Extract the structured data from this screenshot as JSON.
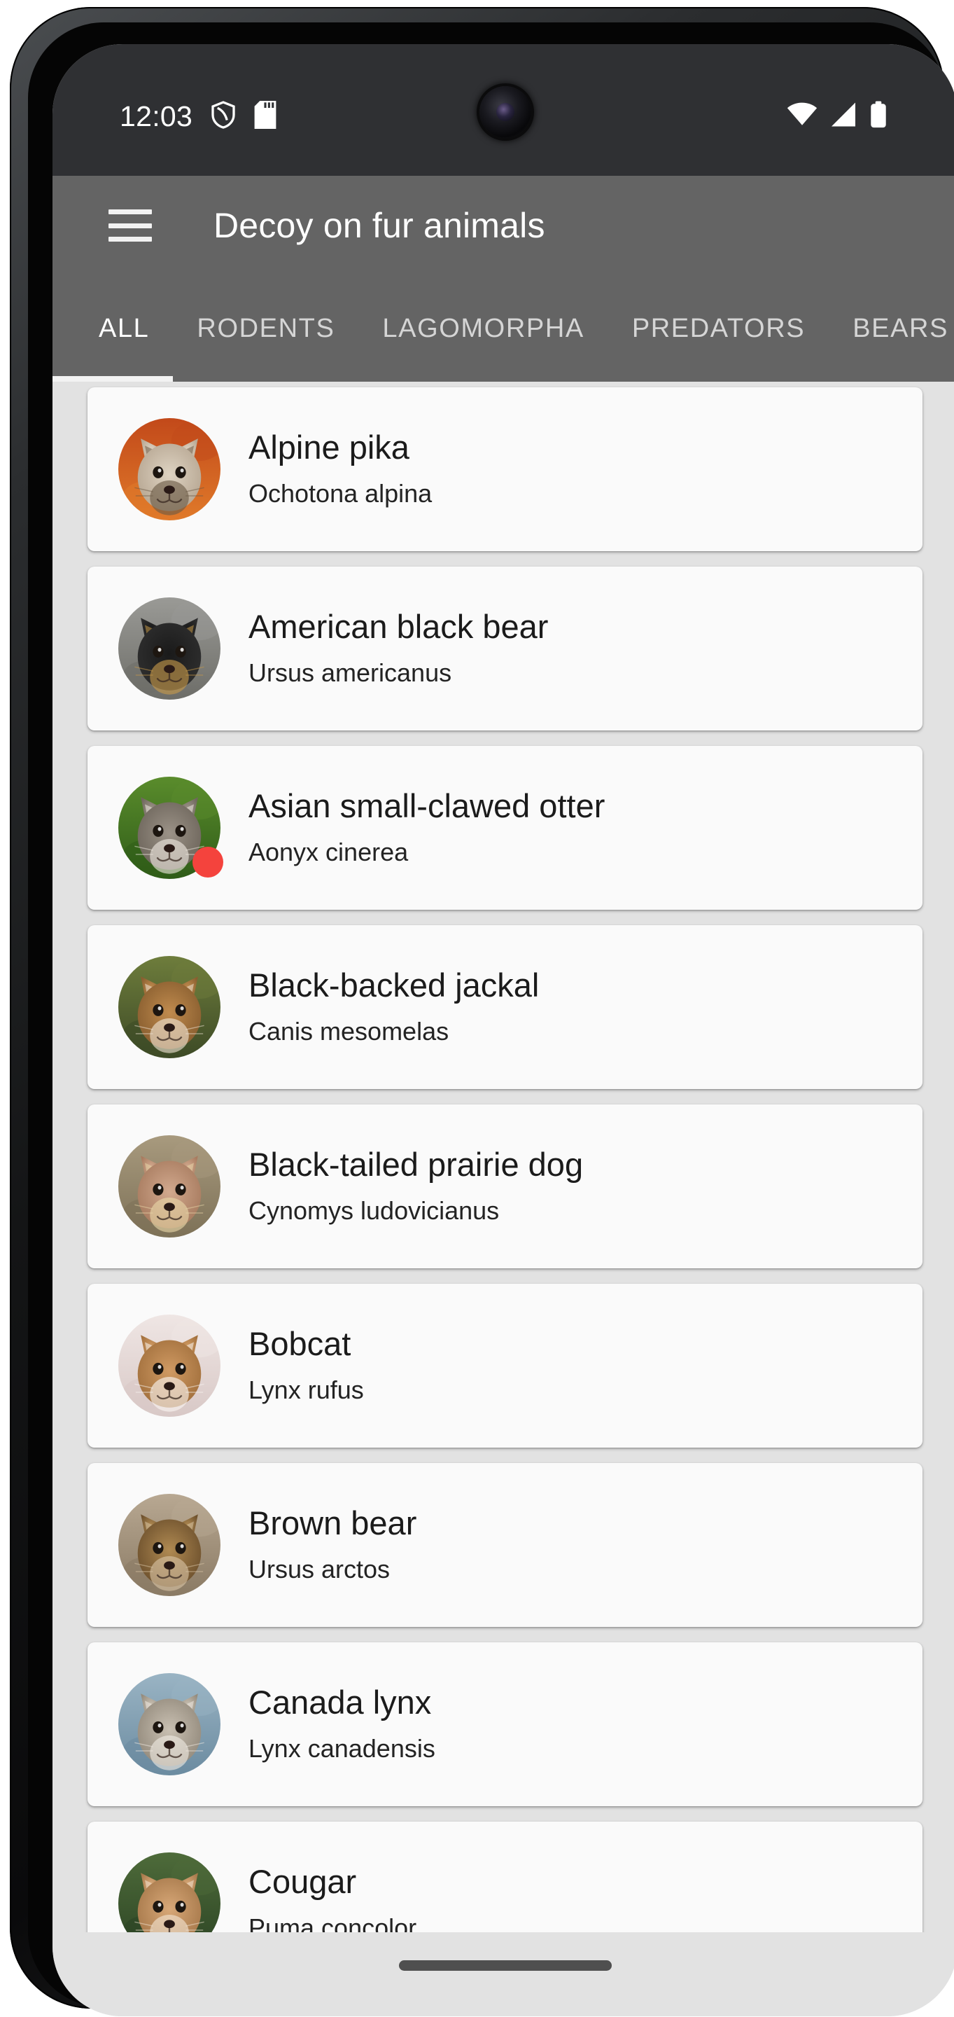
{
  "status_bar": {
    "clock": "12:03",
    "left_icons": [
      "shield-icon",
      "sd-card-icon"
    ],
    "right_icons": [
      "wifi-icon",
      "cellular-signal-icon",
      "battery-icon"
    ],
    "background_color": "#2f3033"
  },
  "app_bar": {
    "menu_icon": "hamburger-menu-icon",
    "title": "Decoy on fur animals",
    "background_color": "#646464"
  },
  "tabs": {
    "active_index": 0,
    "items": [
      {
        "label": "ALL"
      },
      {
        "label": "RODENTS"
      },
      {
        "label": "LAGOMORPHA"
      },
      {
        "label": "PREDATORS"
      },
      {
        "label": "BEARS"
      }
    ]
  },
  "list": {
    "background_color": "#e2e2e2",
    "card_color": "#fafafa",
    "badge_color": "#f4433d",
    "items": [
      {
        "name": "Alpine pika",
        "latin": "Ochotona alpina",
        "badge": false,
        "image": "alpine-pika-photo",
        "palette": {
          "bg_a": "#c2491a",
          "bg_b": "#e07a2a",
          "fur_a": "#ded3c2",
          "fur_b": "#b8a894",
          "accent": "#6b5a46"
        }
      },
      {
        "name": "American black bear",
        "latin": "Ursus americanus",
        "badge": false,
        "image": "american-black-bear-photo",
        "palette": {
          "bg_a": "#9a9a96",
          "bg_b": "#6d6d68",
          "fur_a": "#1a1a1a",
          "fur_b": "#2e2e2e",
          "accent": "#c79a4a"
        }
      },
      {
        "name": "Asian small-clawed otter",
        "latin": "Aonyx cinerea",
        "badge": true,
        "image": "asian-small-clawed-otter-photo",
        "palette": {
          "bg_a": "#5a8c2c",
          "bg_b": "#2f5c18",
          "fur_a": "#9b9287",
          "fur_b": "#6f675d",
          "accent": "#efe9e0"
        }
      },
      {
        "name": "Black-backed jackal",
        "latin": "Canis mesomelas",
        "badge": false,
        "image": "black-backed-jackal-photo",
        "palette": {
          "bg_a": "#6e7d3c",
          "bg_b": "#3d4a26",
          "fur_a": "#c08b4e",
          "fur_b": "#8a5f30",
          "accent": "#efe4d4"
        }
      },
      {
        "name": "Black-tailed prairie dog",
        "latin": "Cynomys ludovicianus",
        "badge": false,
        "image": "black-tailed-prairie-dog-photo",
        "palette": {
          "bg_a": "#a89a7e",
          "bg_b": "#7d7157",
          "fur_a": "#d2a98e",
          "fur_b": "#a87c60",
          "accent": "#e8d6a8"
        }
      },
      {
        "name": "Bobcat",
        "latin": "Lynx rufus",
        "badge": false,
        "image": "bobcat-photo",
        "palette": {
          "bg_a": "#efe6e4",
          "bg_b": "#d8c8c6",
          "fur_a": "#d09a63",
          "fur_b": "#a3713e",
          "accent": "#faf6f2"
        }
      },
      {
        "name": "Brown bear",
        "latin": "Ursus arctos",
        "badge": false,
        "image": "brown-bear-photo",
        "palette": {
          "bg_a": "#b8a892",
          "bg_b": "#8a7a64",
          "fur_a": "#b08a52",
          "fur_b": "#6f522e",
          "accent": "#d8c4a4"
        }
      },
      {
        "name": "Canada lynx",
        "latin": "Lynx canadensis",
        "badge": false,
        "image": "canada-lynx-photo",
        "palette": {
          "bg_a": "#9ab4c4",
          "bg_b": "#6b8ba0",
          "fur_a": "#c9c0b2",
          "fur_b": "#958c7e",
          "accent": "#efeae2"
        }
      },
      {
        "name": "Cougar",
        "latin": "Puma concolor",
        "badge": false,
        "image": "cougar-photo",
        "palette": {
          "bg_a": "#4e6b3a",
          "bg_b": "#2c4424",
          "fur_a": "#d8a878",
          "fur_b": "#a87a4c",
          "accent": "#f2e4d2"
        }
      }
    ]
  },
  "nav_bar": {
    "gesture_pill": "home-gesture-pill"
  }
}
